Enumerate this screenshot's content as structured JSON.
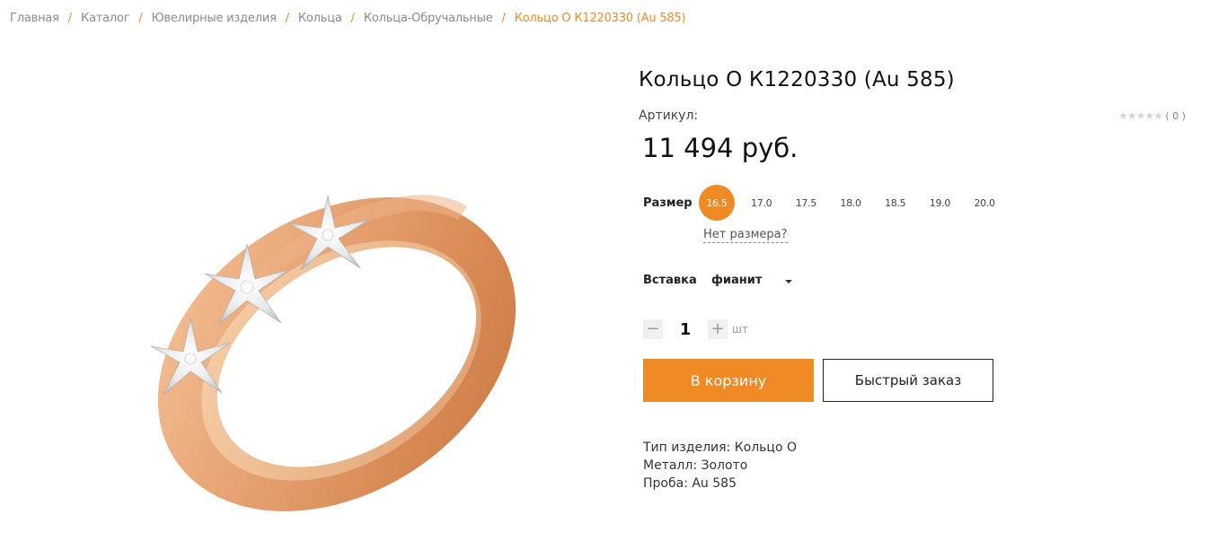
{
  "breadcrumb": {
    "items": [
      "Главная",
      "Каталог",
      "Ювелирные изделия",
      "Кольца",
      "Кольца-Обручальные"
    ],
    "separator": "/",
    "current": "Кольцо О К1220330 (Au 585)"
  },
  "product": {
    "title": "Кольцо О К1220330 (Au 585)",
    "sku_label": "Артикул:",
    "price": "11 494 руб.",
    "rating": {
      "stars_icon": "★★★★★",
      "count": "( 0 )"
    }
  },
  "size": {
    "label": "Размер",
    "options": [
      "16.5",
      "17.0",
      "17.5",
      "18.0",
      "18.5",
      "19.0",
      "20.0"
    ],
    "selected": "16.5",
    "no_size_link": "Нет размера?"
  },
  "insert": {
    "label": "Вставка",
    "value": "фианит"
  },
  "quantity": {
    "minus": "−",
    "value": "1",
    "plus": "+",
    "unit": "шт"
  },
  "buttons": {
    "cart": "В корзину",
    "quick_order": "Быстрый заказ"
  },
  "specs": [
    {
      "text": "Тип изделия: Кольцо О"
    },
    {
      "text": "Металл: Золото"
    },
    {
      "text": "Проба: Au 585"
    }
  ],
  "colors": {
    "accent": "#f08a24",
    "gold": "#e7a878"
  }
}
